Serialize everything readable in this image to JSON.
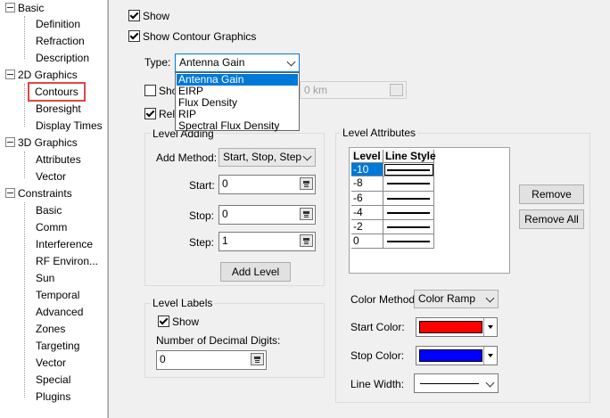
{
  "tree": {
    "groups": [
      {
        "label": "Basic",
        "items": [
          "Definition",
          "Refraction",
          "Description"
        ]
      },
      {
        "label": "2D Graphics",
        "items": [
          "Contours",
          "Boresight",
          "Display Times"
        ]
      },
      {
        "label": "3D Graphics",
        "items": [
          "Attributes",
          "Vector"
        ]
      },
      {
        "label": "Constraints",
        "items": [
          "Basic",
          "Comm",
          "Interference",
          "RF Environ...",
          "Sun",
          "Temporal",
          "Advanced",
          "Zones",
          "Targeting",
          "Vector",
          "Special",
          "Plugins"
        ]
      }
    ],
    "selected": "Contours"
  },
  "main": {
    "show_label": "Show",
    "show_contour_label": "Show Contour Graphics",
    "type_label": "Type:",
    "type_value": "Antenna Gain",
    "type_options": [
      "Antenna Gain",
      "EIRP",
      "Flux Density",
      "RIP",
      "Spectral Flux Density"
    ],
    "hidden_check_label": "Sho",
    "hidden_check2_label": "Rela",
    "hidden_field_unit": "0 km",
    "level_adding": {
      "title": "Level Adding",
      "add_method_label": "Add Method:",
      "add_method_value": "Start, Stop, Step",
      "start_label": "Start:",
      "start_value": "0",
      "stop_label": "Stop:",
      "stop_value": "0",
      "step_label": "Step:",
      "step_value": "1",
      "add_level_button": "Add Level"
    },
    "level_labels": {
      "title": "Level Labels",
      "show_label": "Show",
      "decimal_label": "Number of Decimal Digits:",
      "decimal_value": "0"
    },
    "level_attributes": {
      "title": "Level Attributes",
      "col_level": "Level",
      "col_linestyle": "Line Style",
      "levels": [
        "-10",
        "-8",
        "-6",
        "-4",
        "-2",
        "0"
      ],
      "remove_button": "Remove",
      "remove_all_button": "Remove All",
      "color_method_label": "Color Method:",
      "color_method_value": "Color Ramp",
      "start_color_label": "Start Color:",
      "start_color": "#ff0000",
      "stop_color_label": "Stop Color:",
      "stop_color": "#0000ff",
      "line_width_label": "Line Width:"
    }
  }
}
